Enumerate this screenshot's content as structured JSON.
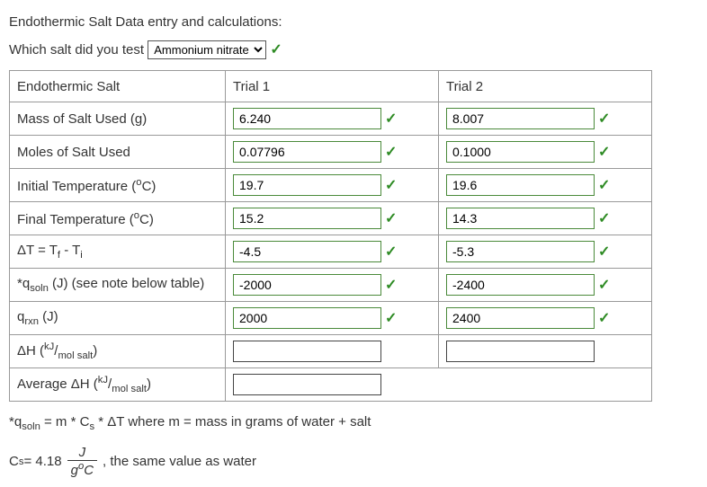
{
  "header": "Endothermic Salt Data entry and calculations:",
  "question": "Which salt did you test",
  "salt_selected": "Ammonium nitrate",
  "table": {
    "hdr_salt": "Endothermic Salt",
    "hdr_t1": "Trial 1",
    "hdr_t2": "Trial 2",
    "rows": {
      "mass_label": "Mass of Salt Used (g)",
      "mass_t1": "6.240",
      "mass_t2": "8.007",
      "moles_label": "Moles of Salt Used",
      "moles_t1": "0.07796",
      "moles_t2": "0.1000",
      "ti_label_pre": "Initial Temperature (",
      "ti_label_unit": "o",
      "ti_label_post": "C)",
      "ti_t1": "19.7",
      "ti_t2": "19.6",
      "tf_label_pre": "Final Temperature (",
      "tf_label_unit": "o",
      "tf_label_post": "C)",
      "tf_t1": "15.2",
      "tf_t2": "14.3",
      "dt_label": "ΔT = T",
      "dt_f": "f",
      "dt_mid": " - T",
      "dt_i": "i",
      "dt_t1": "-4.5",
      "dt_t2": "-5.3",
      "qsoln_label_pre": "*q",
      "qsoln_sub": "soln",
      "qsoln_label_post": " (J) (see note below table)",
      "qsoln_t1": "-2000",
      "qsoln_t2": "-2400",
      "qrxn_pre": "q",
      "qrxn_sub": "rxn",
      "qrxn_post": " (J)",
      "qrxn_t1": "2000",
      "qrxn_t2": "2400",
      "dh_pre": "ΔH (",
      "dh_num": "kJ",
      "dh_slash": "/",
      "dh_den": "mol salt",
      "dh_post": ")",
      "avg_pre": "Average ΔH (",
      "avg_num": "kJ",
      "avg_slash": "/",
      "avg_den": "mol salt",
      "avg_post": ")"
    }
  },
  "note_pre": "*q",
  "note_sub": "soln",
  "note_post": " = m * C",
  "note_s": "s",
  "note_rest": " * ΔT  where m = mass in grams of water + salt",
  "cs_pre": "C",
  "cs_sub": "s",
  "cs_eq": " = 4.18 ",
  "cs_J": "J",
  "cs_g": "g",
  "cs_oC_o": "o",
  "cs_oC_C": "C",
  "cs_tail": " ,  the same value as water"
}
